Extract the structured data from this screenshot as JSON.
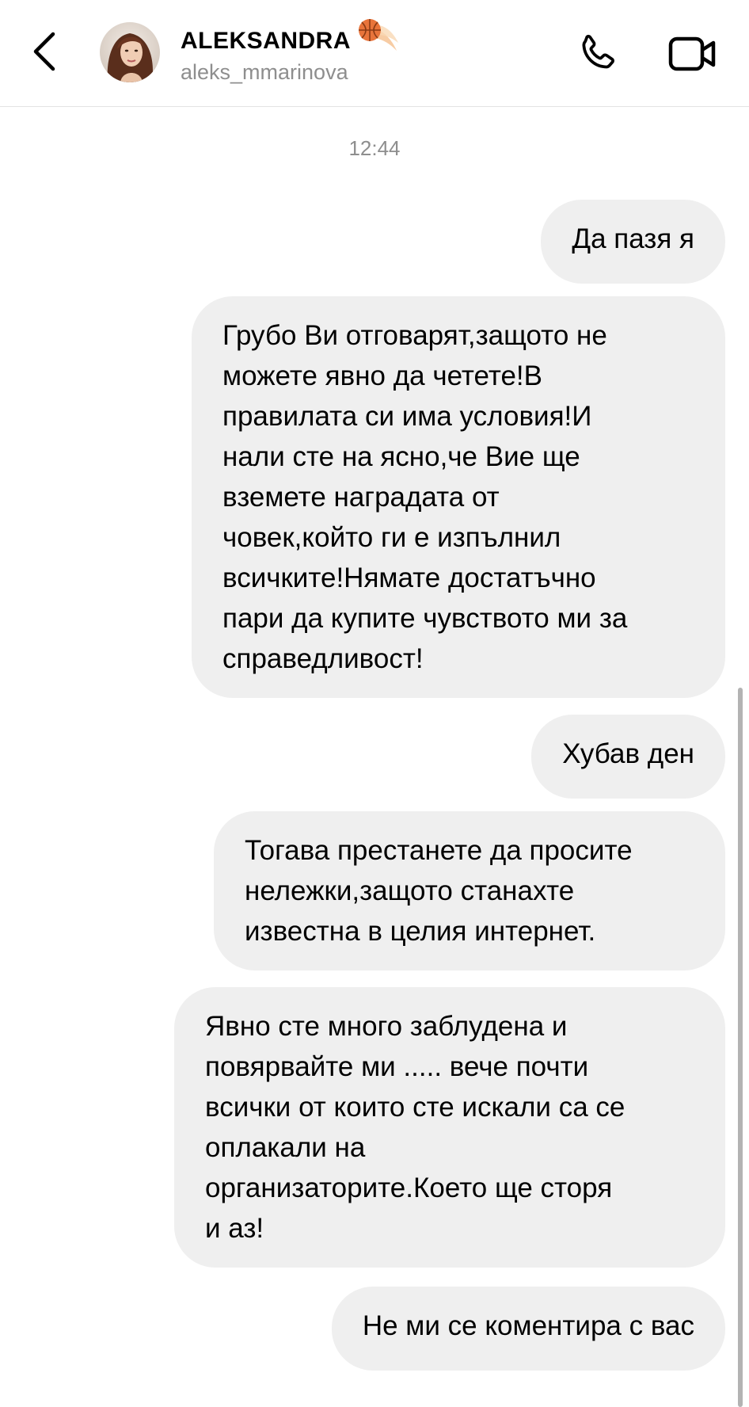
{
  "header": {
    "name": "ALEKSANDRA",
    "handle": "aleks_mmarinova",
    "icons": {
      "back": "chevron-left-icon",
      "badge": "basketball-emoji-icon",
      "call": "phone-icon",
      "video": "video-camera-icon"
    },
    "colors": {
      "badge": "#e8743b"
    }
  },
  "chat": {
    "timestamp": "12:44",
    "messages": [
      {
        "text": "Да пазя я"
      },
      {
        "text": "Грубо Ви отговарят,защото не\nможете явно да четете!В\nправилата си има условия!И\nнали сте на ясно,че Вие ще\nвземете наградата от\nчовек,който ги е изпълнил\nвсичките!Нямате достатъчно\nпари да купите чувството ми за\nсправедливост!"
      },
      {
        "text": "Хубав ден"
      },
      {
        "text": "Тогава престанете да просите\nнележки,защото станахте\nизвестна в целия интернет."
      },
      {
        "text": "Явно сте много заблудена и\nповярвайте ми ..... вече почти\nвсички от които сте искали са се\nоплакали на\nорганизаторите.Което ще сторя\nи аз!"
      },
      {
        "text": "Не ми се коментира с вас"
      }
    ],
    "colors": {
      "bubble": "#efefef",
      "muted": "#8e8e8e"
    }
  }
}
